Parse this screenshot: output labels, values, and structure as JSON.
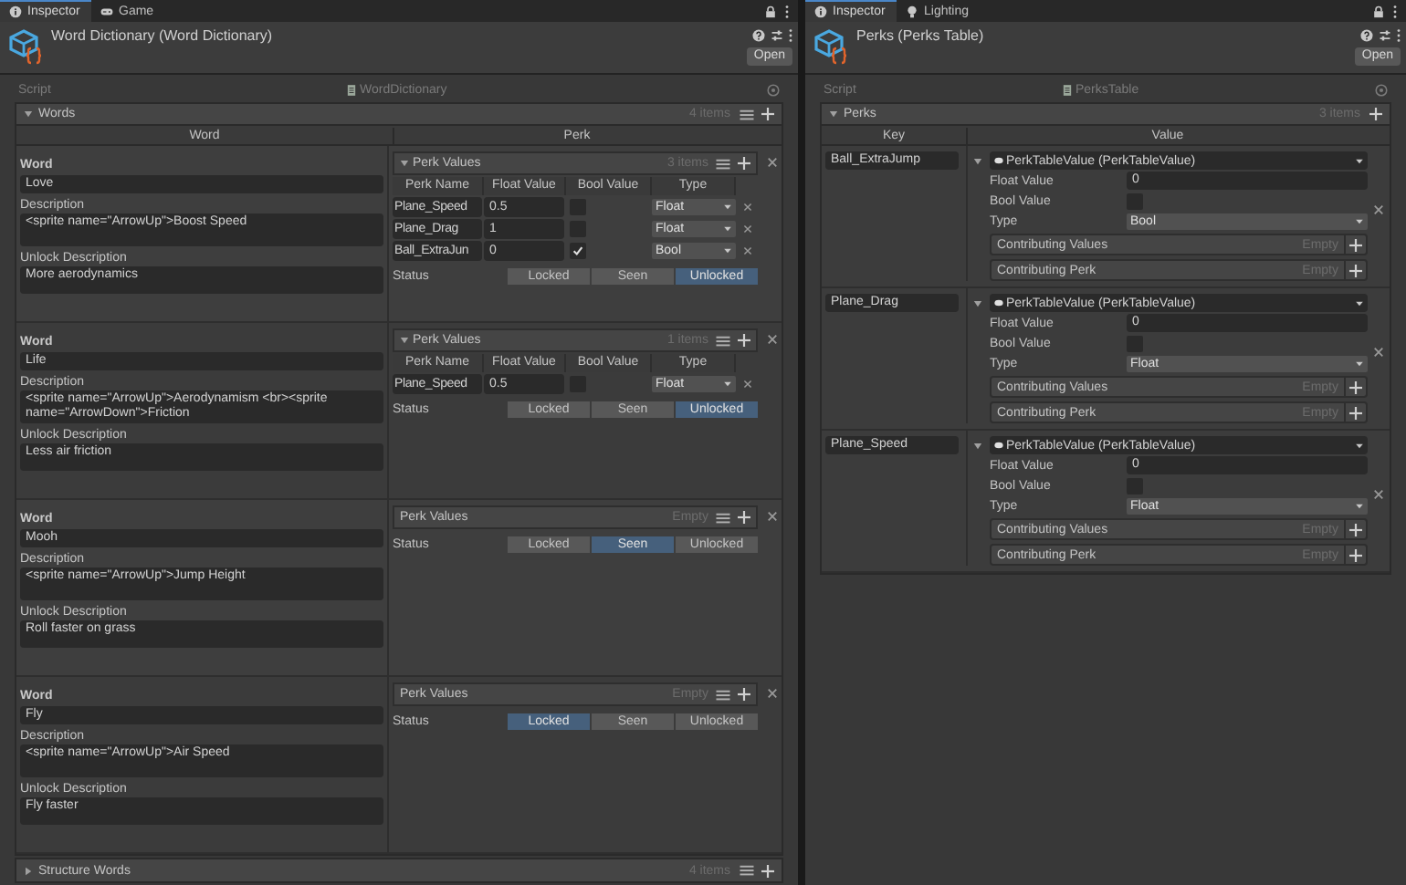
{
  "word_inspector": {
    "tabs": [
      {
        "label": "Inspector",
        "selected": true
      },
      {
        "label": "Game",
        "selected": false
      }
    ],
    "title": "Word Dictionary (Word Dictionary)",
    "open_button": "Open",
    "script": {
      "label": "Script",
      "value": "WordDictionary"
    },
    "list": {
      "label": "Words",
      "expanded": true,
      "count": "4 items",
      "columns": [
        "Word",
        "Perk"
      ],
      "elements": [
        {
          "word_label": "Word",
          "word": "Love",
          "description_label": "Description",
          "description": "<sprite name=\"ArrowUp\">Boost Speed",
          "unlock_label": "Unlock Description",
          "unlock_description": "More aerodynamics",
          "perk_values": {
            "label": "Perk Values",
            "expanded": true,
            "count": "3 items",
            "columns": [
              "Perk Name",
              "Float Value",
              "Bool Value",
              "Type"
            ],
            "rows": [
              {
                "name": "Plane_Speed",
                "float": "0.5",
                "bool": false,
                "type": "Float"
              },
              {
                "name": "Plane_Drag",
                "float": "1",
                "bool": false,
                "type": "Float"
              },
              {
                "name": "Ball_ExtraJun",
                "float": "0",
                "bool": true,
                "type": "Bool"
              }
            ]
          },
          "status": {
            "label": "Status",
            "options": [
              {
                "label": "Locked",
                "selected": false
              },
              {
                "label": "Seen",
                "selected": false
              },
              {
                "label": "Unlocked",
                "selected": true
              }
            ]
          }
        },
        {
          "word_label": "Word",
          "word": "Life",
          "description_label": "Description",
          "description": "<sprite name=\"ArrowUp\">Aerodynamism <br><sprite name=\"ArrowDown\">Friction",
          "unlock_label": "Unlock Description",
          "unlock_description": "Less air friction",
          "perk_values": {
            "label": "Perk Values",
            "expanded": true,
            "count": "1 items",
            "columns": [
              "Perk Name",
              "Float Value",
              "Bool Value",
              "Type"
            ],
            "rows": [
              {
                "name": "Plane_Speed",
                "float": "0.5",
                "bool": false,
                "type": "Float"
              }
            ]
          },
          "status": {
            "label": "Status",
            "options": [
              {
                "label": "Locked",
                "selected": false
              },
              {
                "label": "Seen",
                "selected": false
              },
              {
                "label": "Unlocked",
                "selected": true
              }
            ]
          }
        },
        {
          "word_label": "Word",
          "word": "Mooh",
          "description_label": "Description",
          "description": "<sprite name=\"ArrowUp\">Jump Height",
          "unlock_label": "Unlock Description",
          "unlock_description": "Roll faster on grass",
          "perk_values": {
            "label": "Perk Values",
            "expanded": false,
            "count": "Empty"
          },
          "status": {
            "label": "Status",
            "options": [
              {
                "label": "Locked",
                "selected": false
              },
              {
                "label": "Seen",
                "selected": true
              },
              {
                "label": "Unlocked",
                "selected": false
              }
            ]
          }
        },
        {
          "word_label": "Word",
          "word": "Fly",
          "description_label": "Description",
          "description": "<sprite name=\"ArrowUp\">Air Speed",
          "unlock_label": "Unlock Description",
          "unlock_description": "Fly faster",
          "perk_values": {
            "label": "Perk Values",
            "expanded": false,
            "count": "Empty"
          },
          "status": {
            "label": "Status",
            "options": [
              {
                "label": "Locked",
                "selected": true
              },
              {
                "label": "Seen",
                "selected": false
              },
              {
                "label": "Unlocked",
                "selected": false
              }
            ]
          }
        }
      ]
    },
    "structure_words": {
      "label": "Structure Words",
      "expanded": false,
      "count": "4 items"
    }
  },
  "perks_inspector": {
    "tabs": [
      {
        "label": "Inspector",
        "selected": true
      },
      {
        "label": "Lighting",
        "selected": false
      }
    ],
    "title": "Perks (Perks Table)",
    "open_button": "Open",
    "script": {
      "label": "Script",
      "value": "PerksTable"
    },
    "list": {
      "label": "Perks",
      "expanded": true,
      "count": "3 items",
      "columns": [
        "Key",
        "Value"
      ],
      "elements": [
        {
          "key": "Ball_ExtraJump",
          "value_title": "PerkTableValue (PerkTableValue)",
          "fields": [
            {
              "kind": "text",
              "label": "Float Value",
              "value": "0"
            },
            {
              "kind": "checkbox",
              "label": "Bool Value",
              "checked": false
            },
            {
              "kind": "dropdown",
              "label": "Type",
              "value": "Bool"
            }
          ],
          "lists": [
            {
              "label": "Contributing Values",
              "count": "Empty"
            },
            {
              "label": "Contributing Perk",
              "count": "Empty"
            }
          ]
        },
        {
          "key": "Plane_Drag",
          "value_title": "PerkTableValue (PerkTableValue)",
          "fields": [
            {
              "kind": "text",
              "label": "Float Value",
              "value": "0"
            },
            {
              "kind": "checkbox",
              "label": "Bool Value",
              "checked": false
            },
            {
              "kind": "dropdown",
              "label": "Type",
              "value": "Float"
            }
          ],
          "lists": [
            {
              "label": "Contributing Values",
              "count": "Empty"
            },
            {
              "label": "Contributing Perk",
              "count": "Empty"
            }
          ]
        },
        {
          "key": "Plane_Speed",
          "value_title": "PerkTableValue (PerkTableValue)",
          "fields": [
            {
              "kind": "text",
              "label": "Float Value",
              "value": "0"
            },
            {
              "kind": "checkbox",
              "label": "Bool Value",
              "checked": false
            },
            {
              "kind": "dropdown",
              "label": "Type",
              "value": "Float"
            }
          ],
          "lists": [
            {
              "label": "Contributing Values",
              "count": "Empty"
            },
            {
              "label": "Contributing Perk",
              "count": "Empty"
            }
          ]
        }
      ]
    }
  }
}
